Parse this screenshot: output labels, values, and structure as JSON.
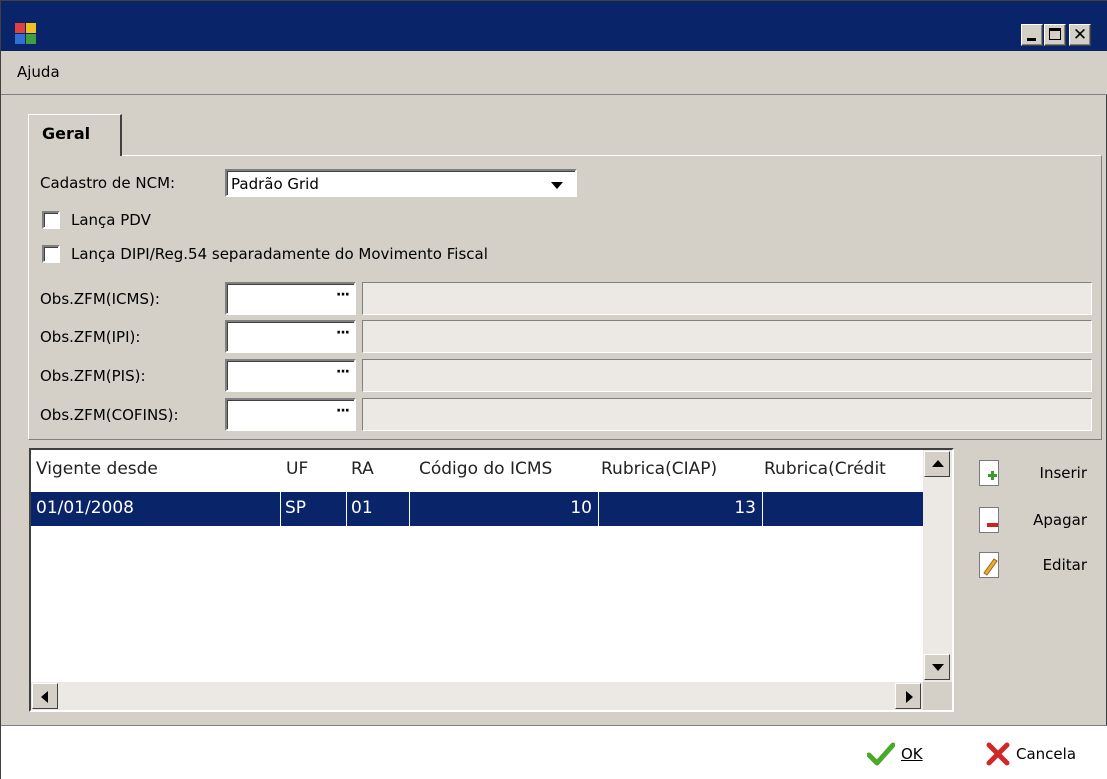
{
  "window": {
    "title": "",
    "controls": {
      "minimize": "_",
      "maximize": "□",
      "close": "✕"
    }
  },
  "menu": {
    "items": [
      "Ajuda"
    ]
  },
  "tabs": [
    {
      "label": "Geral",
      "active": true
    }
  ],
  "form": {
    "cadastro_label": "Cadastro de NCM:",
    "cadastro_value": "Padrão Grid",
    "checkboxes": [
      {
        "label": "Lança PDV",
        "checked": false
      },
      {
        "label": "Lança DIPI/Reg.54 separadamente do Movimento Fiscal",
        "checked": false
      }
    ],
    "obs_fields": [
      {
        "label": "Obs.ZFM(ICMS):",
        "value": ""
      },
      {
        "label": "Obs.ZFM(IPI):",
        "value": ""
      },
      {
        "label": "Obs.ZFM(PIS):",
        "value": ""
      },
      {
        "label": "Obs.ZFM(COFINS):",
        "value": ""
      }
    ],
    "ellipsis": "···"
  },
  "grid": {
    "columns": [
      "Vigente desde",
      "UF",
      "RA",
      "Código do ICMS",
      "Rubrica(CIAP)",
      "Rubrica(Crédit"
    ],
    "rows": [
      {
        "vigente": "01/01/2008",
        "uf": "SP",
        "ra": "01",
        "icms": "10",
        "ciap": "13",
        "credito": ""
      }
    ]
  },
  "actions": {
    "insert": "Inserir",
    "delete": "Apagar",
    "edit": "Editar"
  },
  "footer": {
    "ok": "OK",
    "cancel": "Cancela"
  },
  "colors": {
    "titlebar": "#0a246a",
    "selection": "#0a246a",
    "face": "#d4d0c8"
  }
}
